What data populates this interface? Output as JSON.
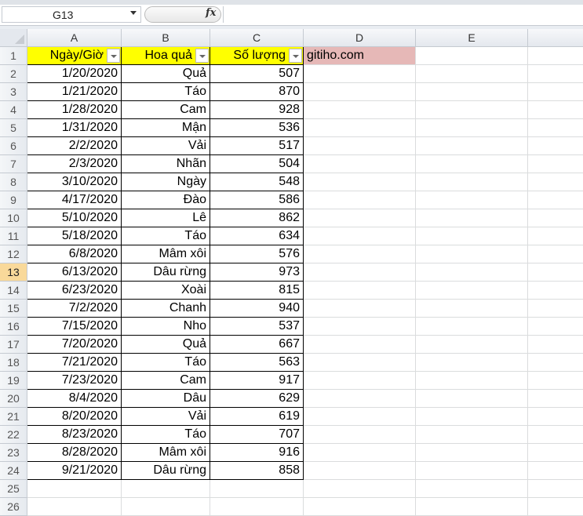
{
  "name_box": "G13",
  "fx_label": "fx",
  "columns": [
    "A",
    "B",
    "C",
    "D",
    "E",
    ""
  ],
  "header": [
    "Ngày/Giờ",
    "Hoa quả",
    "Số lượng"
  ],
  "note": "gitiho.com",
  "note_color": "#e6b8b7",
  "selected_row": 13,
  "rows": [
    [
      "1/20/2020",
      "Quả",
      "507"
    ],
    [
      "1/21/2020",
      "Táo",
      "870"
    ],
    [
      "1/28/2020",
      "Cam",
      "928"
    ],
    [
      "1/31/2020",
      "Mận",
      "536"
    ],
    [
      "2/2/2020",
      "Vải",
      "517"
    ],
    [
      "2/3/2020",
      "Nhãn",
      "504"
    ],
    [
      "3/10/2020",
      "Ngày",
      "548"
    ],
    [
      "4/17/2020",
      "Đào",
      "586"
    ],
    [
      "5/10/2020",
      "Lê",
      "862"
    ],
    [
      "5/18/2020",
      "Táo",
      "634"
    ],
    [
      "6/8/2020",
      "Mâm xôi",
      "576"
    ],
    [
      "6/13/2020",
      "Dâu rừng",
      "973"
    ],
    [
      "6/23/2020",
      "Xoài",
      "815"
    ],
    [
      "7/2/2020",
      "Chanh",
      "940"
    ],
    [
      "7/15/2020",
      "Nho",
      "537"
    ],
    [
      "7/20/2020",
      "Quả",
      "667"
    ],
    [
      "7/21/2020",
      "Táo",
      "563"
    ],
    [
      "7/23/2020",
      "Cam",
      "917"
    ],
    [
      "8/4/2020",
      "Dâu",
      "629"
    ],
    [
      "8/20/2020",
      "Vải",
      "619"
    ],
    [
      "8/23/2020",
      "Táo",
      "707"
    ],
    [
      "8/28/2020",
      "Mâm xôi",
      "916"
    ],
    [
      "9/21/2020",
      "Dâu rừng",
      "858"
    ]
  ],
  "row_numbers": [
    "1",
    "2",
    "3",
    "4",
    "5",
    "6",
    "7",
    "8",
    "9",
    "10",
    "11",
    "12",
    "13",
    "14",
    "15",
    "16",
    "17",
    "18",
    "19",
    "20",
    "21",
    "22",
    "23",
    "24",
    "25",
    "26"
  ]
}
